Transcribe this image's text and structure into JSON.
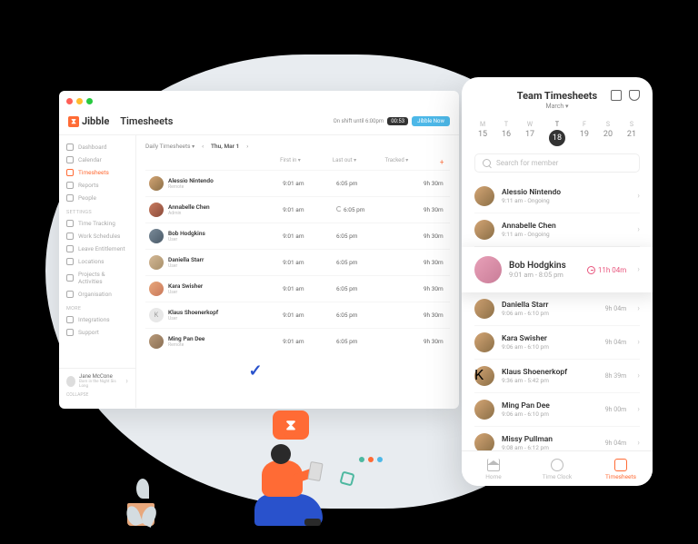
{
  "desktop": {
    "brand": "Jibble",
    "title": "Timesheets",
    "status_text": "On shift until 6:00pm",
    "status_time": "00:53",
    "status_btn": "Jibble Now",
    "sidebar": {
      "items": [
        {
          "label": "Dashboard"
        },
        {
          "label": "Calendar"
        },
        {
          "label": "Timesheets"
        },
        {
          "label": "Reports"
        },
        {
          "label": "People"
        }
      ],
      "settings_h": "SETTINGS",
      "settings": [
        {
          "label": "Time Tracking"
        },
        {
          "label": "Work Schedules"
        },
        {
          "label": "Leave Entitlement"
        },
        {
          "label": "Locations"
        },
        {
          "label": "Projects & Activities"
        },
        {
          "label": "Organisation"
        }
      ],
      "more_h": "MORE",
      "more": [
        {
          "label": "Integrations"
        },
        {
          "label": "Support"
        }
      ],
      "user_name": "Jane McCone",
      "user_sub": "Born in the Night Sis Long",
      "collapse": "COLLAPSE"
    },
    "filters": {
      "view": "Daily Timesheets",
      "date": "Thu, Mar 1"
    },
    "columns": {
      "c1": "",
      "c2": "First in",
      "c3": "Last out",
      "c4": "Tracked"
    },
    "rows": [
      {
        "name": "Alessio Nintendo",
        "role": "Remote",
        "in": "9:01 am",
        "out": "6:05 pm",
        "tracked": "9h 30m"
      },
      {
        "name": "Annabelle Chen",
        "role": "Admin",
        "in": "9:01 am",
        "out": "6:05 pm",
        "out_moon": true,
        "tracked": "9h 30m"
      },
      {
        "name": "Bob Hodgkins",
        "role": "User",
        "in": "9:01 am",
        "out": "6:05 pm",
        "tracked": "9h 30m"
      },
      {
        "name": "Daniella Starr",
        "role": "User",
        "in": "9:01 am",
        "out": "6:05 pm",
        "tracked": "9h 30m"
      },
      {
        "name": "Kara Swisher",
        "role": "User",
        "in": "9:01 am",
        "out": "6:05 pm",
        "tracked": "9h 30m"
      },
      {
        "name": "Klaus Shoenerkopf",
        "role": "User",
        "in": "9:01 am",
        "out": "6:05 pm",
        "tracked": "9h 30m"
      },
      {
        "name": "Ming Pan Dee",
        "role": "Remote",
        "in": "9:01 am",
        "out": "6:05 pm",
        "tracked": "9h 30m"
      }
    ]
  },
  "mobile": {
    "title": "Team Timesheets",
    "month": "March",
    "week": [
      {
        "d": "M",
        "n": "15"
      },
      {
        "d": "T",
        "n": "16"
      },
      {
        "d": "W",
        "n": "17"
      },
      {
        "d": "T",
        "n": "18",
        "active": true
      },
      {
        "d": "F",
        "n": "19"
      },
      {
        "d": "S",
        "n": "20"
      },
      {
        "d": "S",
        "n": "21"
      }
    ],
    "search_ph": "Search for member",
    "rows": [
      {
        "name": "Alessio Nintendo",
        "time": "9:11 am - Ongoing",
        "dur": ""
      },
      {
        "name": "Annabelle Chen",
        "time": "9:11 am - Ongoing",
        "dur": ""
      },
      {
        "name": "Bob Hodgkins",
        "time": "9:01 am - 8:05 pm",
        "dur": "11h 04m",
        "hl": true
      },
      {
        "name": "Daniella Starr",
        "time": "9:06 am - 6:10 pm",
        "dur": "9h 04m"
      },
      {
        "name": "Kara Swisher",
        "time": "9:06 am - 6:10 pm",
        "dur": "9h 04m"
      },
      {
        "name": "Klaus Shoenerkopf",
        "time": "9:36 am - 5:42 pm",
        "dur": "8h 39m"
      },
      {
        "name": "Ming Pan Dee",
        "time": "9:06 am - 6:10 pm",
        "dur": "9h 00m"
      },
      {
        "name": "Missy Pullman",
        "time": "9:08 am - 6:12 pm",
        "dur": "9h 04m"
      }
    ],
    "tabs": [
      {
        "label": "Home"
      },
      {
        "label": "Time Clock"
      },
      {
        "label": "Timesheets",
        "active": true
      }
    ]
  }
}
